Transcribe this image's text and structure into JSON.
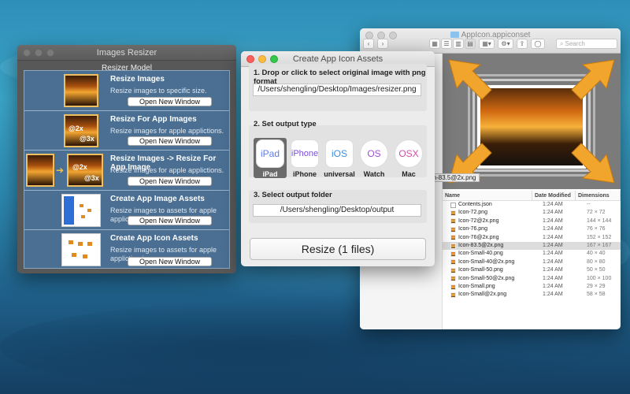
{
  "resizer": {
    "title": "Images Resizer",
    "model_title": "Resizer Model",
    "open_label": "Open New Window",
    "rows": [
      {
        "title": "Resize Images",
        "desc": "Resize images to specific size."
      },
      {
        "title": "Resize For App Images",
        "desc": "Resize images for apple applictions."
      },
      {
        "title": "Resize Images -> Resize For App Image",
        "desc": "Resize images for apple applictions."
      },
      {
        "title": "Create App Image Assets",
        "desc": "Resize images to assets for apple appliction images."
      },
      {
        "title": "Create App Icon Assets",
        "desc": "Resize images to assets for apple appliction icons"
      }
    ],
    "thumb_badges": {
      "x2": "@2x",
      "x3": "@3x"
    }
  },
  "create": {
    "title": "Create App Icon Assets",
    "step1": "1. Drop or click to select original image with png format",
    "input_path": "/Users/shengling/Desktop/Images/resizer.png",
    "step2": "2. Set output type",
    "types": [
      {
        "icon": "iPad",
        "label": "iPad"
      },
      {
        "icon": "iPhone",
        "label": "iPhone"
      },
      {
        "icon": "iOS",
        "label": "universal"
      },
      {
        "icon": "OS",
        "label": "Watch"
      },
      {
        "icon": "OSX",
        "label": "Mac"
      }
    ],
    "step3": "3. Select output folder",
    "output_path": "/Users/shengling/Desktop/output",
    "resize_label": "Resize (1 files)"
  },
  "finder": {
    "title": "AppIcon.appiconset",
    "search_placeholder": "Search",
    "preview_caption": "Icon-83.5@2x.png",
    "columns": {
      "name": "Name",
      "date": "Date Modified",
      "dim": "Dimensions"
    },
    "files": [
      {
        "name": "Contents.json",
        "date": "1:24 AM",
        "dim": "--",
        "type": "json"
      },
      {
        "name": "Icon-72.png",
        "date": "1:24 AM",
        "dim": "72 × 72",
        "type": "png"
      },
      {
        "name": "Icon-72@2x.png",
        "date": "1:24 AM",
        "dim": "144 × 144",
        "type": "png"
      },
      {
        "name": "Icon-76.png",
        "date": "1:24 AM",
        "dim": "76 × 76",
        "type": "png"
      },
      {
        "name": "Icon-76@2x.png",
        "date": "1:24 AM",
        "dim": "152 × 152",
        "type": "png"
      },
      {
        "name": "Icon-83.5@2x.png",
        "date": "1:24 AM",
        "dim": "167 × 167",
        "type": "png",
        "selected": true
      },
      {
        "name": "Icon-Small-40.png",
        "date": "1:24 AM",
        "dim": "40 × 40",
        "type": "png"
      },
      {
        "name": "Icon-Small-40@2x.png",
        "date": "1:24 AM",
        "dim": "80 × 80",
        "type": "png"
      },
      {
        "name": "Icon-Small-50.png",
        "date": "1:24 AM",
        "dim": "50 × 50",
        "type": "png"
      },
      {
        "name": "Icon-Small-50@2x.png",
        "date": "1:24 AM",
        "dim": "100 × 100",
        "type": "png"
      },
      {
        "name": "Icon-Small.png",
        "date": "1:24 AM",
        "dim": "29 × 29",
        "type": "png"
      },
      {
        "name": "Icon-Small@2x.png",
        "date": "1:24 AM",
        "dim": "58 × 58",
        "type": "png"
      }
    ]
  }
}
